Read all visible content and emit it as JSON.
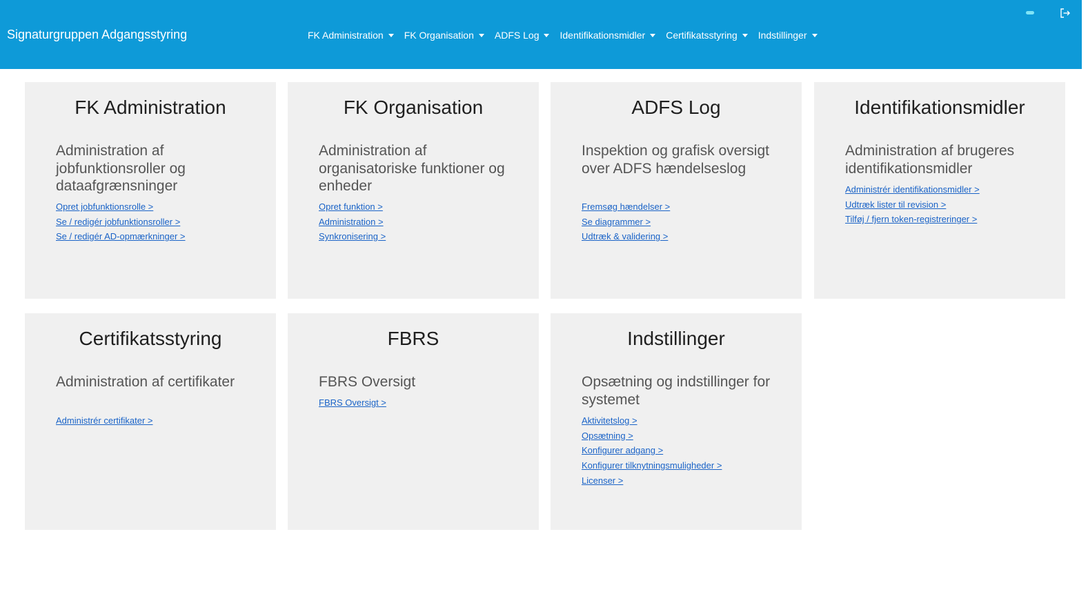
{
  "header": {
    "brand": "Signaturgruppen Adgangsstyring",
    "menu": [
      {
        "label": "FK Administration"
      },
      {
        "label": "FK Organisation"
      },
      {
        "label": "ADFS Log"
      },
      {
        "label": "Identifikationsmidler"
      },
      {
        "label": "Certifikatsstyring"
      },
      {
        "label": "Indstillinger"
      }
    ],
    "logout_icon": "logout-icon",
    "accent_color": "#0e9ad8"
  },
  "cards": [
    {
      "title": "FK Administration",
      "description": "Administration af jobfunktionsroller og dataafgrænsninger",
      "links": [
        {
          "label": "Opret jobfunktionsrolle >"
        },
        {
          "label": "Se / redigér jobfunktionsroller >"
        },
        {
          "label": "Se / redigér AD-opmærkninger >"
        }
      ]
    },
    {
      "title": "FK Organisation",
      "description": "Administration af organisatoriske funktioner og enheder",
      "links": [
        {
          "label": "Opret funktion >"
        },
        {
          "label": "Administration >"
        },
        {
          "label": "Synkronisering >"
        }
      ]
    },
    {
      "title": "ADFS Log",
      "description": "Inspektion og grafisk oversigt over ADFS hændelseslog",
      "links": [
        {
          "label": "Fremsøg hændelser >"
        },
        {
          "label": "Se diagrammer >"
        },
        {
          "label": "Udtræk & validering >"
        }
      ]
    },
    {
      "title": "Identifikationsmidler",
      "description": "Administration af brugeres identifikationsmidler",
      "links": [
        {
          "label": "Administrér identifikationsmidler >"
        },
        {
          "label": "Udtræk lister til revision >"
        },
        {
          "label": "Tilføj / fjern token-registreringer >"
        }
      ]
    },
    {
      "title": "Certifikatsstyring",
      "description": "Administration af certifikater",
      "links": [
        {
          "label": "Administrér certifikater >"
        }
      ]
    },
    {
      "title": "FBRS",
      "description": "FBRS Oversigt",
      "links": [
        {
          "label": "FBRS Oversigt >"
        }
      ]
    },
    {
      "title": "Indstillinger",
      "description": "Opsætning og indstillinger for systemet",
      "links": [
        {
          "label": "Aktivitetslog >"
        },
        {
          "label": "Opsætning >"
        },
        {
          "label": "Konfigurer adgang >"
        },
        {
          "label": "Konfigurer tilknytningsmuligheder >"
        },
        {
          "label": "Licenser >"
        }
      ]
    }
  ]
}
